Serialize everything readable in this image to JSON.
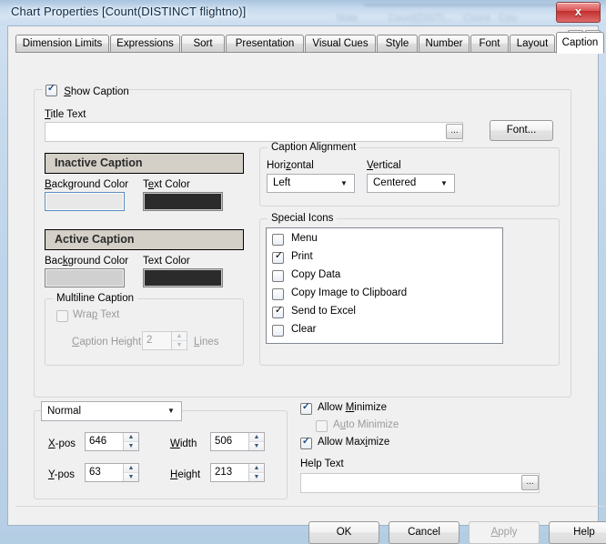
{
  "window": {
    "title": "Chart Properties [Count(DISTINCT flightno)]",
    "close_label": "x",
    "close_icon": "close-icon"
  },
  "tabs": {
    "items": [
      {
        "label": "Dimension Limits",
        "active": false
      },
      {
        "label": "Expressions",
        "active": false
      },
      {
        "label": "Sort",
        "active": false
      },
      {
        "label": "Presentation",
        "active": false
      },
      {
        "label": "Visual Cues",
        "active": false
      },
      {
        "label": "Style",
        "active": false
      },
      {
        "label": "Number",
        "active": false
      },
      {
        "label": "Font",
        "active": false
      },
      {
        "label": "Layout",
        "active": false
      },
      {
        "label": "Caption",
        "active": true
      }
    ],
    "nav_prev": "◄",
    "nav_next": "►"
  },
  "caption": {
    "show_caption_label": "Show Caption",
    "show_caption_checked": true,
    "title_text_label": "Title Text",
    "title_text_value": "",
    "title_text_browse": "...",
    "font_button": "Font...",
    "inactive": {
      "preview_text": "Inactive Caption",
      "preview_bg": "#d4d0c8",
      "preview_fg": "#2b2b2b",
      "background_label": "Background Color",
      "background_value": "#e8e8e8",
      "text_label": "Text Color",
      "text_value": "#2b2b2b"
    },
    "active": {
      "preview_text": "Active Caption",
      "preview_bg": "#d4d0c8",
      "preview_fg": "#2b2b2b",
      "background_label": "Background Color",
      "background_value": "#d0d0d0",
      "text_label": "Text Color",
      "text_value": "#2b2b2b"
    },
    "multiline": {
      "group_title": "Multiline Caption",
      "wrap_text_label": "Wrap Text",
      "wrap_text_checked": false,
      "caption_height_label": "Caption Height",
      "caption_height_value": "2",
      "lines_label": "Lines"
    }
  },
  "alignment": {
    "group_title": "Caption Alignment",
    "horizontal_label": "Horizontal",
    "horizontal_value": "Left",
    "vertical_label": "Vertical",
    "vertical_value": "Centered",
    "caret": "▼"
  },
  "special_icons": {
    "group_title": "Special Icons",
    "items": [
      {
        "label": "Menu",
        "checked": false
      },
      {
        "label": "Print",
        "checked": true
      },
      {
        "label": "Copy Data",
        "checked": false
      },
      {
        "label": "Copy Image to Clipboard",
        "checked": false
      },
      {
        "label": "Send to Excel",
        "checked": true
      },
      {
        "label": "Clear",
        "checked": false
      }
    ]
  },
  "position": {
    "mode_value": "Normal",
    "caret": "▼",
    "xpos_label": "X-pos",
    "xpos_value": "646",
    "ypos_label": "Y-pos",
    "ypos_value": "63",
    "width_label": "Width",
    "width_value": "506",
    "height_label": "Height",
    "height_value": "213",
    "spin_up": "▲",
    "spin_down": "▼"
  },
  "window_options": {
    "allow_minimize_label": "Allow Minimize",
    "allow_minimize_checked": true,
    "auto_minimize_label": "Auto Minimize",
    "auto_minimize_checked": false,
    "allow_maximize_label": "Allow Maximize",
    "allow_maximize_checked": true,
    "help_text_label": "Help Text",
    "help_text_value": "",
    "help_text_browse": "..."
  },
  "footer": {
    "ok": "OK",
    "cancel": "Cancel",
    "apply": "Apply",
    "help": "Help"
  }
}
